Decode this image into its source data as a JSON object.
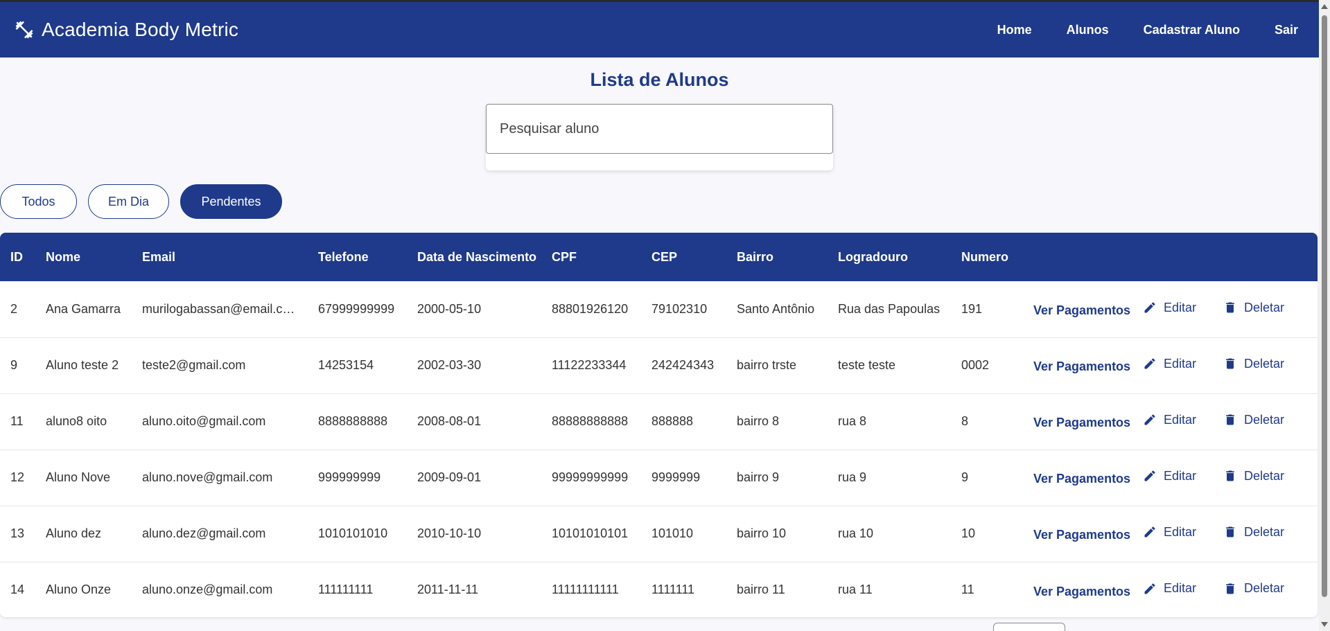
{
  "app": {
    "title": "Academia Body Metric",
    "icon": "dumbbell-icon",
    "colors": {
      "primary": "#1f3a8a",
      "background": "#f8f7fc"
    }
  },
  "nav": {
    "home": "Home",
    "alunos": "Alunos",
    "cadastrar": "Cadastrar Aluno",
    "sair": "Sair"
  },
  "page": {
    "title": "Lista de Alunos"
  },
  "search": {
    "placeholder": "Pesquisar aluno",
    "value": ""
  },
  "filters": {
    "todos": "Todos",
    "em_dia": "Em Dia",
    "pendentes": "Pendentes",
    "active": "Pendentes"
  },
  "table": {
    "headers": [
      "ID",
      "Nome",
      "Email",
      "Telefone",
      "Data de Nascimento",
      "CPF",
      "CEP",
      "Bairro",
      "Logradouro",
      "Numero",
      ""
    ],
    "actions": {
      "payments": "Ver Pagamentos",
      "edit": "Editar",
      "edit_icon": "pencil-icon",
      "delete": "Deletar",
      "delete_icon": "trash-icon"
    },
    "rows": [
      {
        "id": "2",
        "nome": "Ana Gamarra",
        "email": "murilogabassan@email.c…",
        "telefone": "67999999999",
        "nascimento": "2000-05-10",
        "cpf": "88801926120",
        "cep": "79102310",
        "bairro": "Santo Antônio",
        "logradouro": "Rua das Papoulas",
        "numero": "191"
      },
      {
        "id": "9",
        "nome": "Aluno teste 2",
        "email": "teste2@gmail.com",
        "telefone": "14253154",
        "nascimento": "2002-03-30",
        "cpf": "11122233344",
        "cep": "242424343",
        "bairro": "bairro trste",
        "logradouro": "teste teste",
        "numero": "0002"
      },
      {
        "id": "11",
        "nome": "aluno8 oito",
        "email": "aluno.oito@gmail.com",
        "telefone": "8888888888",
        "nascimento": "2008-08-01",
        "cpf": "88888888888",
        "cep": "888888",
        "bairro": "bairro 8",
        "logradouro": "rua 8",
        "numero": "8"
      },
      {
        "id": "12",
        "nome": "Aluno Nove",
        "email": "aluno.nove@gmail.com",
        "telefone": "999999999",
        "nascimento": "2009-09-01",
        "cpf": "99999999999",
        "cep": "9999999",
        "bairro": "bairro 9",
        "logradouro": "rua 9",
        "numero": "9"
      },
      {
        "id": "13",
        "nome": "Aluno dez",
        "email": "aluno.dez@gmail.com",
        "telefone": "1010101010",
        "nascimento": "2010-10-10",
        "cpf": "10101010101",
        "cep": "101010",
        "bairro": "bairro 10",
        "logradouro": "rua 10",
        "numero": "10"
      },
      {
        "id": "14",
        "nome": "Aluno Onze",
        "email": "aluno.onze@gmail.com",
        "telefone": "111111111",
        "nascimento": "2011-11-11",
        "cpf": "11111111111",
        "cep": "1111111",
        "bairro": "bairro 11",
        "logradouro": "rua 11",
        "numero": "11"
      }
    ]
  }
}
